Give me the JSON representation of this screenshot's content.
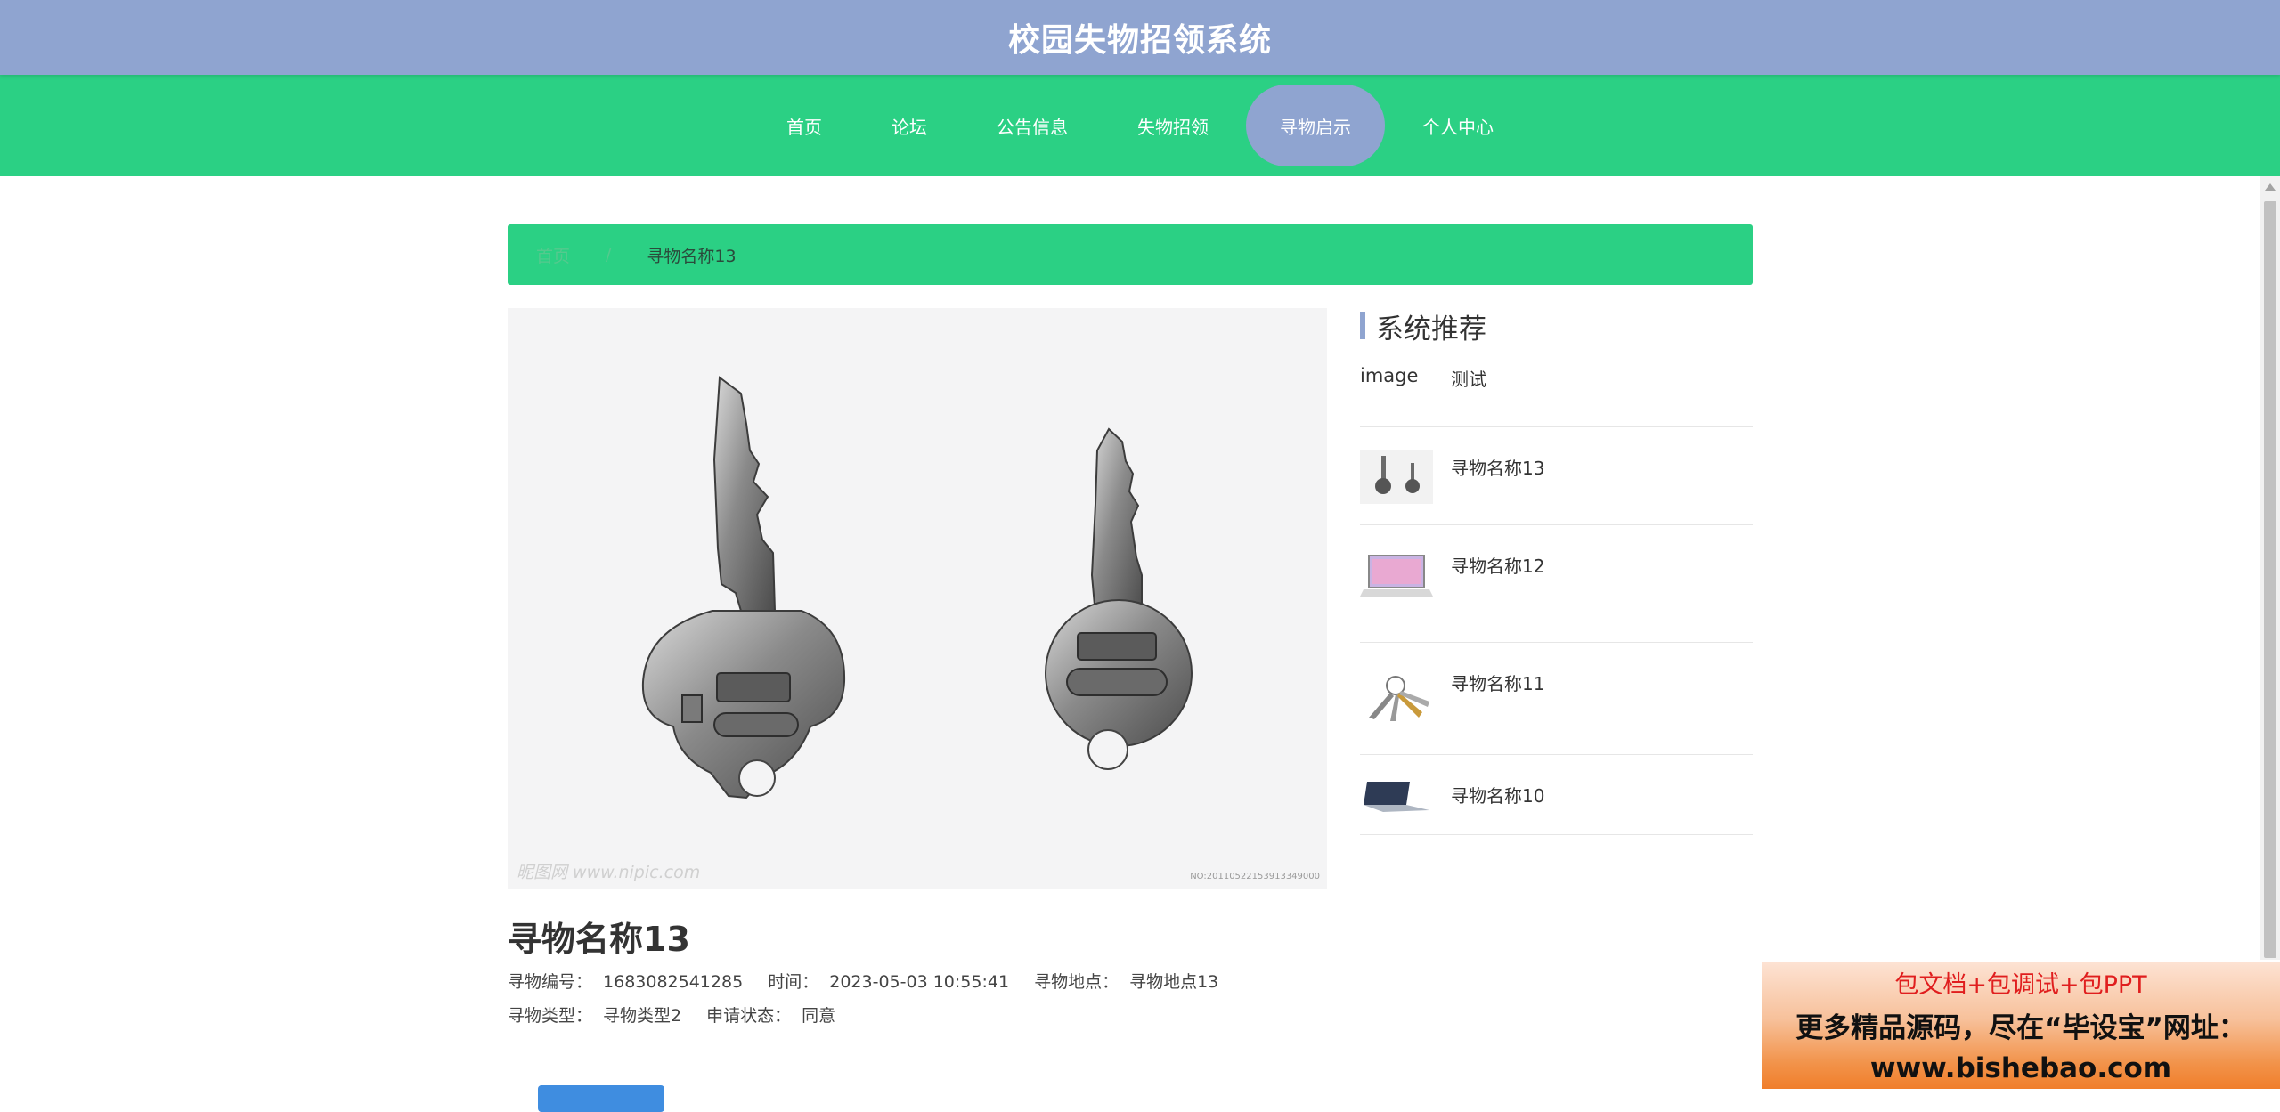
{
  "header": {
    "title": "校园失物招领系统"
  },
  "nav": {
    "items": [
      {
        "label": "首页"
      },
      {
        "label": "论坛"
      },
      {
        "label": "公告信息"
      },
      {
        "label": "失物招领"
      },
      {
        "label": "寻物启示"
      },
      {
        "label": "个人中心"
      }
    ],
    "active": "寻物启示"
  },
  "breadcrumb": {
    "home": "首页",
    "separator": "/",
    "current": "寻物名称13"
  },
  "detail": {
    "image_alt": "keys",
    "watermark_left": "昵图网 www.nipic.com",
    "watermark_right": "NO:20110522153913349000",
    "title": "寻物名称13",
    "fields": {
      "number_label": "寻物编号：",
      "number": "1683082541285",
      "time_label": "时间：",
      "time": "2023-05-03 10:55:41",
      "place_label": "寻物地点：",
      "place": "寻物地点13",
      "type_label": "寻物类型：",
      "type": "寻物类型2",
      "status_label": "申请状态：",
      "status": "同意"
    }
  },
  "sidebar": {
    "title": "系统推荐",
    "items": [
      {
        "title": "测试",
        "thumb": "broken-image",
        "thumb_alt": "image"
      },
      {
        "title": "寻物名称13",
        "thumb": "keys"
      },
      {
        "title": "寻物名称12",
        "thumb": "laptop-pink"
      },
      {
        "title": "寻物名称11",
        "thumb": "keyring"
      },
      {
        "title": "寻物名称10",
        "thumb": "laptop-dark"
      }
    ]
  },
  "ad": {
    "line1": "包文档+包调试+包PPT",
    "line2": "更多精品源码，尽在“毕设宝”网址：",
    "line3": "www.bishebao.com"
  },
  "colors": {
    "header": "#8fa4d0",
    "nav": "#2bd084",
    "accent": "#8fa4d0"
  }
}
